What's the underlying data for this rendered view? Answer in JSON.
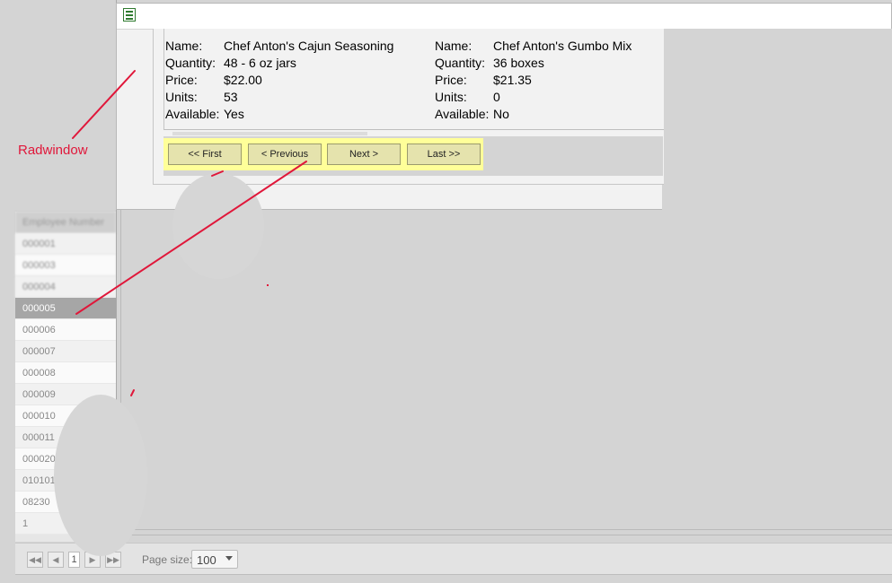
{
  "background_grid": {
    "header": "Employee Number",
    "rows": [
      {
        "label": "000001"
      },
      {
        "label": "000003"
      },
      {
        "label": "000004"
      },
      {
        "label": "000005",
        "selected": true
      },
      {
        "label": "000006"
      },
      {
        "label": "000007"
      },
      {
        "label": "000008"
      },
      {
        "label": "000009"
      },
      {
        "label": "000010"
      },
      {
        "label": "000011"
      },
      {
        "label": "000020"
      },
      {
        "label": "010101"
      },
      {
        "label": "08230"
      },
      {
        "label": "1"
      }
    ]
  },
  "grid_pager": {
    "first_icon": "first-page-icon",
    "prev_icon": "prev-page-icon",
    "page": "1",
    "next_icon": "next-page-icon",
    "last_icon": "last-page-icon",
    "page_size_label": "Page size:",
    "page_size_value": "100"
  },
  "radwindow": {
    "icon": "window-icon",
    "products": [
      {
        "name_label": "Name:",
        "name": "Chef Anton's Cajun Seasoning",
        "quantity_label": "Quantity:",
        "quantity": "48 - 6 oz jars",
        "price_label": "Price:",
        "price": "$22.00",
        "units_label": "Units:",
        "units": "53",
        "available_label": "Available:",
        "available": "Yes"
      },
      {
        "name_label": "Name:",
        "name": "Chef Anton's Gumbo Mix",
        "quantity_label": "Quantity:",
        "quantity": "36 boxes",
        "price_label": "Price:",
        "price": "$21.35",
        "units_label": "Units:",
        "units": "0",
        "available_label": "Available:",
        "available": "No"
      }
    ],
    "nav": {
      "first": "<< First",
      "previous": "< Previous",
      "next": "Next >",
      "last": "Last >>"
    }
  },
  "annotation": {
    "label": "Radwindow",
    "color": "#e0173a"
  }
}
